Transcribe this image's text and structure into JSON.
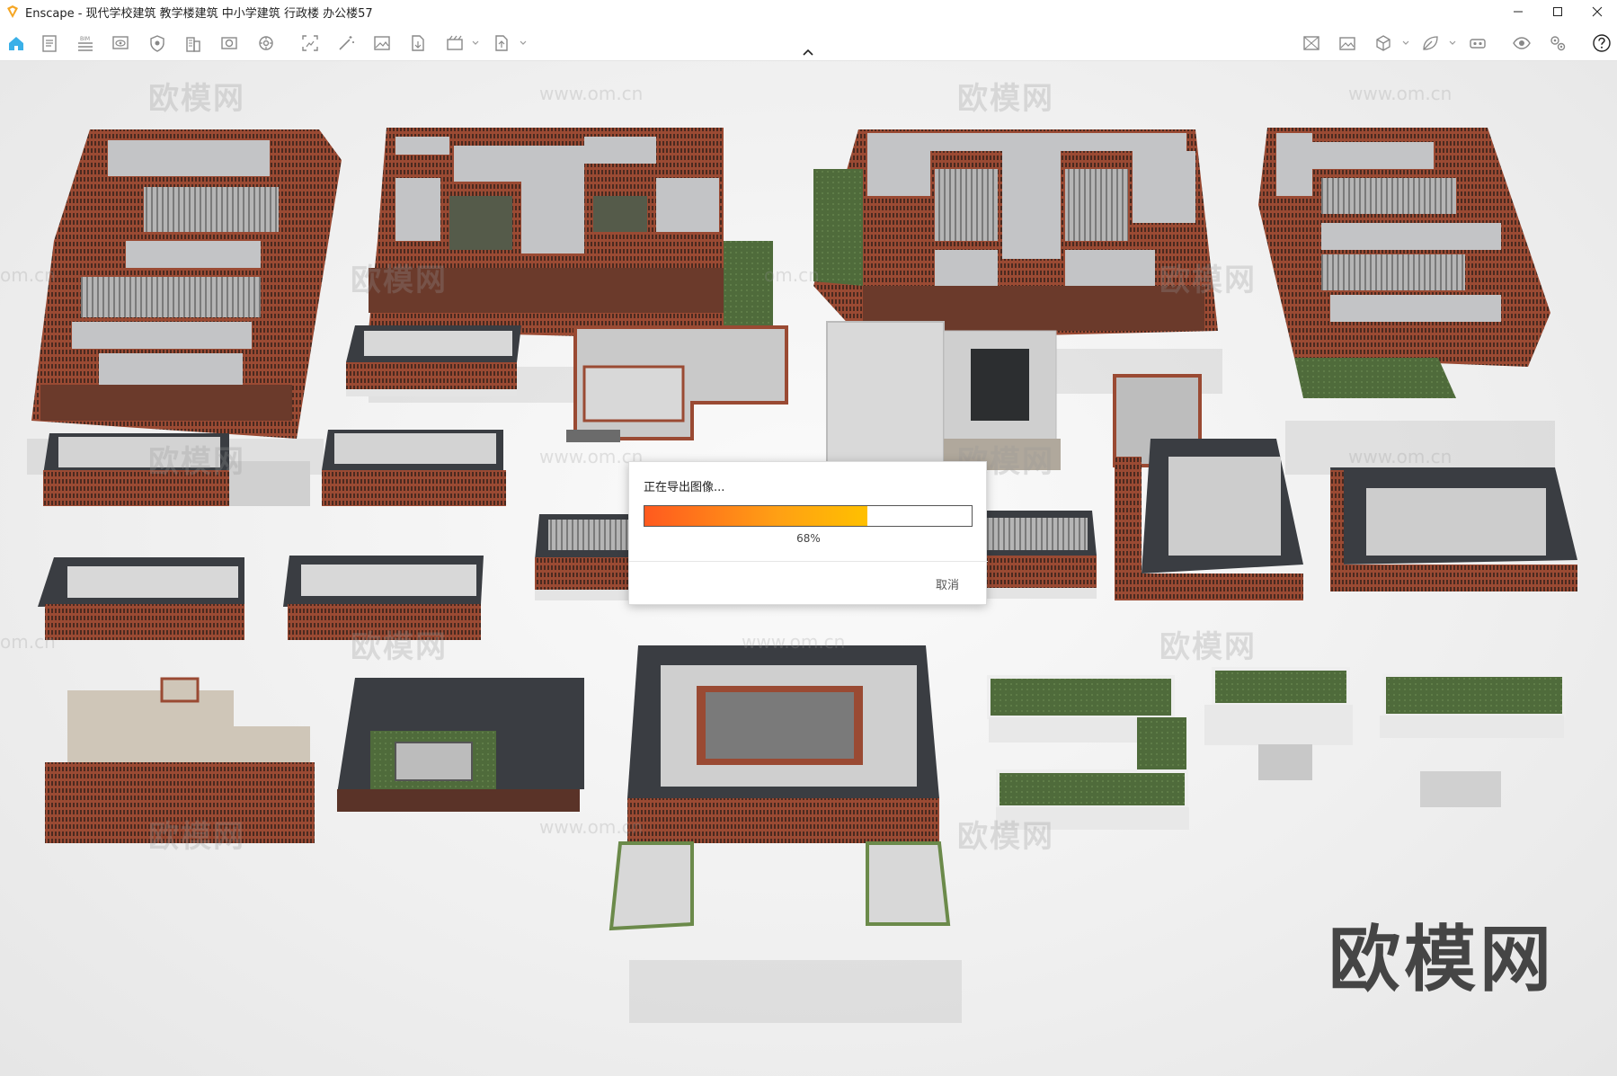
{
  "window": {
    "title": "Enscape - 现代学校建筑 教学楼建筑 中小学建筑 行政楼 办公楼57",
    "controls": [
      "minimize-icon",
      "maximize-icon",
      "close-icon"
    ]
  },
  "toolbar": {
    "left_icons": [
      "home-icon",
      "document-icon",
      "bim-icon",
      "eye-monitor-icon",
      "shield-icon",
      "building-icon",
      "camera-icon",
      "settings-gear-icon",
      "screenshot-icon",
      "magic-wand-icon",
      "image-icon",
      "export-file-icon",
      "video-icon",
      "upload-file-icon"
    ],
    "right_icons": [
      "panorama-icon",
      "image-gallery-icon",
      "cube-icon",
      "material-leaf-icon",
      "vr-headset-icon",
      "eye-icon",
      "settings-icon",
      "help-icon"
    ],
    "bim_label": "BIM"
  },
  "viewport": {
    "watermark_text": "欧模网",
    "watermark_url": "www.om.cn",
    "watermark_url_partial": "om.cn"
  },
  "dialog": {
    "title": "正在导出图像...",
    "progress": 68,
    "progress_label": "68%",
    "cancel_label": "取消"
  }
}
